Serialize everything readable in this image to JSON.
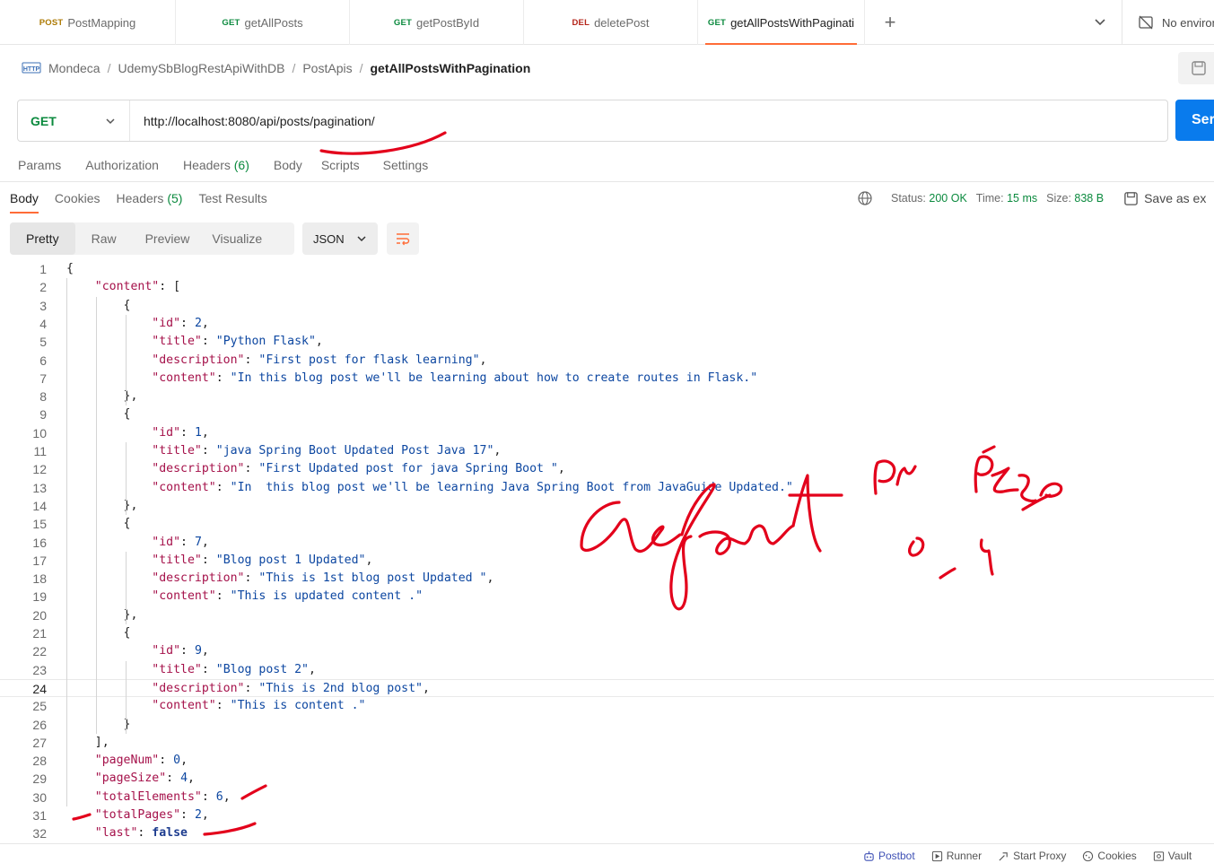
{
  "tabs": [
    {
      "method": "POST",
      "name": "PostMapping",
      "method_color": "#ad7a03",
      "active": false
    },
    {
      "method": "GET",
      "name": "getAllPosts",
      "method_color": "#0b8a3e",
      "active": false
    },
    {
      "method": "GET",
      "name": "getPostById",
      "method_color": "#0b8a3e",
      "active": false
    },
    {
      "method": "DEL",
      "name": "deletePost",
      "method_color": "#b42318",
      "active": false
    },
    {
      "method": "GET",
      "name": "getAllPostsWithPaginati",
      "method_color": "#0b8a3e",
      "active": true
    }
  ],
  "environment": {
    "label": "No environ"
  },
  "breadcrumb": {
    "items": [
      "Mondeca",
      "UdemySbBlogRestApiWithDB",
      "PostApis"
    ],
    "current": "getAllPostsWithPagination",
    "icon": "http-icon"
  },
  "request": {
    "method": "GET",
    "url": "http://localhost:8080/api/posts/pagination/",
    "send_label": "Ser"
  },
  "request_tabs": [
    {
      "label": "Params"
    },
    {
      "label": "Authorization"
    },
    {
      "label": "Headers",
      "count": "(6)"
    },
    {
      "label": "Body"
    },
    {
      "label": "Scripts"
    },
    {
      "label": "Settings"
    }
  ],
  "response_tabs": [
    {
      "label": "Body",
      "active": true
    },
    {
      "label": "Cookies"
    },
    {
      "label": "Headers",
      "count": "(5)"
    },
    {
      "label": "Test Results"
    }
  ],
  "status": {
    "status_label": "Status:",
    "status_value": "200 OK",
    "time_label": "Time:",
    "time_value": "15 ms",
    "size_label": "Size:",
    "size_value": "838 B",
    "save_label": "Save as ex"
  },
  "view": {
    "options": [
      "Pretty",
      "Raw",
      "Preview",
      "Visualize"
    ],
    "selected": "Pretty",
    "format": "JSON"
  },
  "code": {
    "current_line": 24,
    "lines": [
      "{",
      "    \"content\": [",
      "        {",
      "            \"id\": 2,",
      "            \"title\": \"Python Flask\",",
      "            \"description\": \"First post for flask learning\",",
      "            \"content\": \"In this blog post we'll be learning about how to create routes in Flask.\"",
      "        },",
      "        {",
      "            \"id\": 1,",
      "            \"title\": \"java Spring Boot Updated Post Java 17\",",
      "            \"description\": \"First Updated post for java Spring Boot \",",
      "            \"content\": \"In  this blog post we'll be learning Java Spring Boot from JavaGuide Updated.\"",
      "        },",
      "        {",
      "            \"id\": 7,",
      "            \"title\": \"Blog post 1 Updated\",",
      "            \"description\": \"This is 1st blog post Updated \",",
      "            \"content\": \"This is updated content .\"",
      "        },",
      "        {",
      "            \"id\": 9,",
      "            \"title\": \"Blog post 2\",",
      "            \"description\": \"This is 2nd blog post\",",
      "            \"content\": \"This is content .\"",
      "        }",
      "    ],",
      "    \"pageNum\": 0,",
      "    \"pageSize\": 4,",
      "    \"totalElements\": 6,",
      "    \"totalPages\": 2,",
      "    \"last\": false"
    ]
  },
  "footer": {
    "items": [
      {
        "icon": "postbot-icon",
        "label": "Postbot"
      },
      {
        "icon": "runner-icon",
        "label": "Runner"
      },
      {
        "icon": "proxy-icon",
        "label": "Start Proxy"
      },
      {
        "icon": "cookie-icon",
        "label": "Cookies"
      },
      {
        "icon": "vault-icon",
        "label": "Vault"
      }
    ]
  },
  "colors": {
    "accent": "#ff6c37",
    "send": "#097bed",
    "get": "#0b8a3e",
    "annotation": "#e3001b"
  }
}
